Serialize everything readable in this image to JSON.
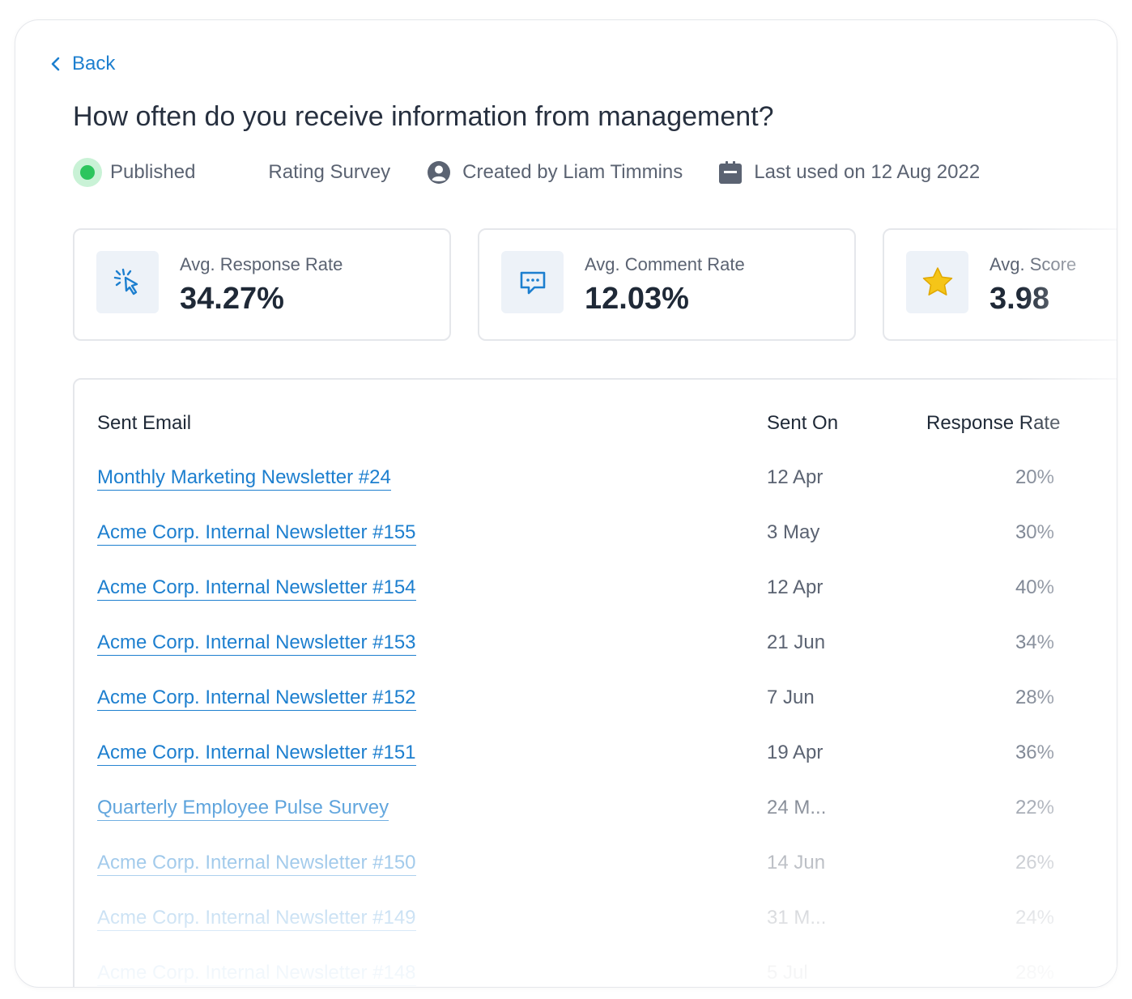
{
  "nav": {
    "back_label": "Back"
  },
  "survey": {
    "title": "How often do you receive information from management?",
    "status": "Published",
    "type": "Rating Survey",
    "created_by": "Created by Liam Timmins",
    "last_used": "Last used on 12 Aug 2022"
  },
  "stats": [
    {
      "label": "Avg. Response Rate",
      "value": "34.27%",
      "icon": "cursor-click-icon"
    },
    {
      "label": "Avg. Comment Rate",
      "value": "12.03%",
      "icon": "comment-icon"
    },
    {
      "label": "Avg. Score",
      "value": "3.98",
      "icon": "star-icon"
    }
  ],
  "table": {
    "headers": {
      "email": "Sent Email",
      "sent_on": "Sent On",
      "rate": "Response Rate"
    },
    "rows": [
      {
        "email": "Monthly Marketing Newsletter #24",
        "sent_on": "12 Apr",
        "rate": "20%"
      },
      {
        "email": "Acme Corp. Internal Newsletter #155",
        "sent_on": "3 May",
        "rate": "30%"
      },
      {
        "email": "Acme Corp. Internal Newsletter #154",
        "sent_on": "12 Apr",
        "rate": "40%"
      },
      {
        "email": "Acme Corp. Internal Newsletter #153",
        "sent_on": "21 Jun",
        "rate": "34%"
      },
      {
        "email": "Acme Corp. Internal Newsletter #152",
        "sent_on": "7 Jun",
        "rate": "28%"
      },
      {
        "email": "Acme Corp. Internal Newsletter #151",
        "sent_on": "19 Apr",
        "rate": "36%"
      },
      {
        "email": "Quarterly Employee Pulse Survey",
        "sent_on": "24 M...",
        "rate": "22%"
      },
      {
        "email": "Acme Corp. Internal Newsletter #150",
        "sent_on": "14 Jun",
        "rate": "26%"
      },
      {
        "email": "Acme Corp. Internal Newsletter #149",
        "sent_on": "31 M...",
        "rate": "24%"
      },
      {
        "email": "Acme Corp. Internal Newsletter #148",
        "sent_on": "5 Jul",
        "rate": "28%"
      }
    ]
  },
  "colors": {
    "link": "#1d7fcf",
    "status": "#2cc55d",
    "star": "#f5c518"
  }
}
